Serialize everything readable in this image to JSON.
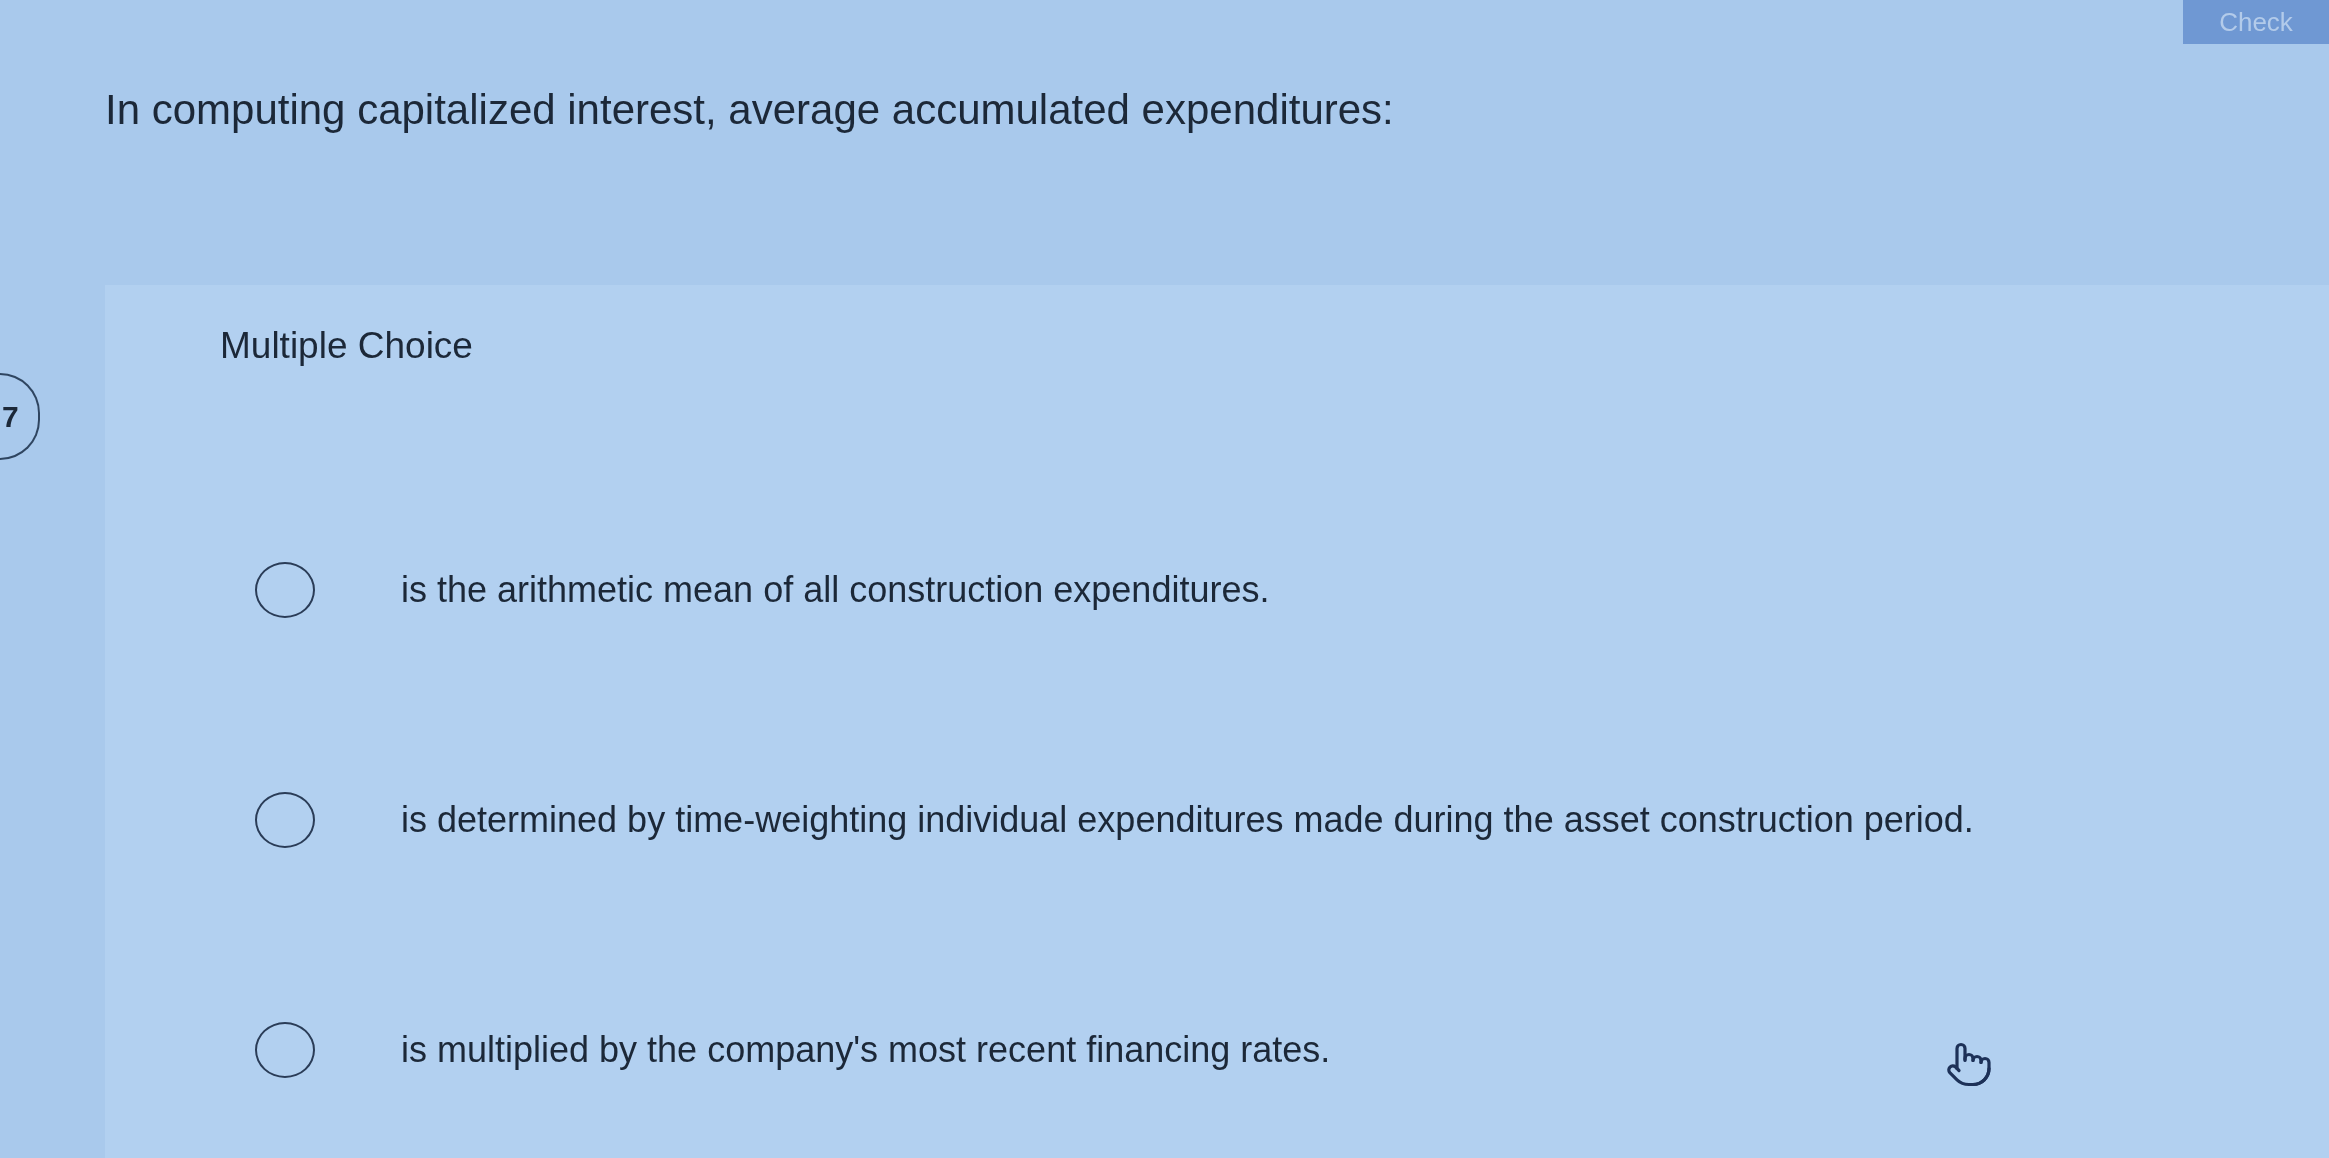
{
  "header": {
    "check_button": "Check"
  },
  "question_number": "7",
  "question": "In computing capitalized interest, average accumulated expenditures:",
  "answer_panel": {
    "type_label": "Multiple Choice",
    "options": [
      {
        "text": "is the arithmetic mean of all construction expenditures.",
        "selected": false
      },
      {
        "text": "is determined by time-weighting individual expenditures made during the asset construction period.",
        "selected": false
      },
      {
        "text": "is multiplied by the company's most recent financing rates.",
        "selected": false
      }
    ]
  }
}
